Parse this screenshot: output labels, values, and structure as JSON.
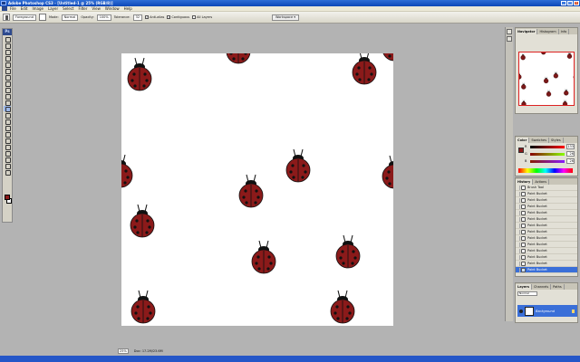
{
  "window": {
    "title": "Adobe Photoshop CS3 - [Untitled-1 @ 25% (RGB/8)]",
    "buttons": [
      "_",
      "□",
      "×"
    ]
  },
  "menu": [
    "File",
    "Edit",
    "Image",
    "Layer",
    "Select",
    "Filter",
    "View",
    "Window",
    "Help"
  ],
  "options": {
    "fill_source": "Foreground",
    "mode_label": "Mode:",
    "mode_value": "Normal",
    "opacity_label": "Opacity:",
    "opacity_value": "100%",
    "tolerance_label": "Tolerance:",
    "tolerance_value": "32",
    "anti_alias": "Anti-alias",
    "contiguous": "Contiguous",
    "all_layers": "All Layers",
    "workspace": "Workspace ▾"
  },
  "toolbox": {
    "header": "Ps"
  },
  "statusbar": {
    "zoom": "25%",
    "doc": "Doc: 17.2M/23.6M"
  },
  "navigator": {
    "tabs": [
      "Navigator",
      "Histogram",
      "Info"
    ]
  },
  "color_panel": {
    "tabs": [
      "Color",
      "Swatches",
      "Styles"
    ],
    "rows": [
      {
        "label": "R",
        "value": "133",
        "color": "#ff0000"
      },
      {
        "label": "G",
        "value": "26",
        "color": "#00aa00"
      },
      {
        "label": "B",
        "value": "26",
        "color": "#0000ff"
      }
    ]
  },
  "history": {
    "tabs": [
      "History",
      "Actions"
    ],
    "items": [
      "Brush Tool",
      "Paint Bucket",
      "Paint Bucket",
      "Paint Bucket",
      "Paint Bucket",
      "Paint Bucket",
      "Paint Bucket",
      "Paint Bucket",
      "Paint Bucket",
      "Paint Bucket",
      "Paint Bucket",
      "Paint Bucket",
      "Paint Bucket",
      "Paint Bucket"
    ],
    "selected_index": 13
  },
  "layers": {
    "tabs": [
      "Layers",
      "Channels",
      "Paths"
    ],
    "blend": "Normal",
    "layer_name": "Background"
  },
  "colors": {
    "ladybug_body": "#8b1a1a",
    "ladybug_dark": "#111111",
    "foreground": "#8b1a1a",
    "accent": "#3a6fd8"
  }
}
